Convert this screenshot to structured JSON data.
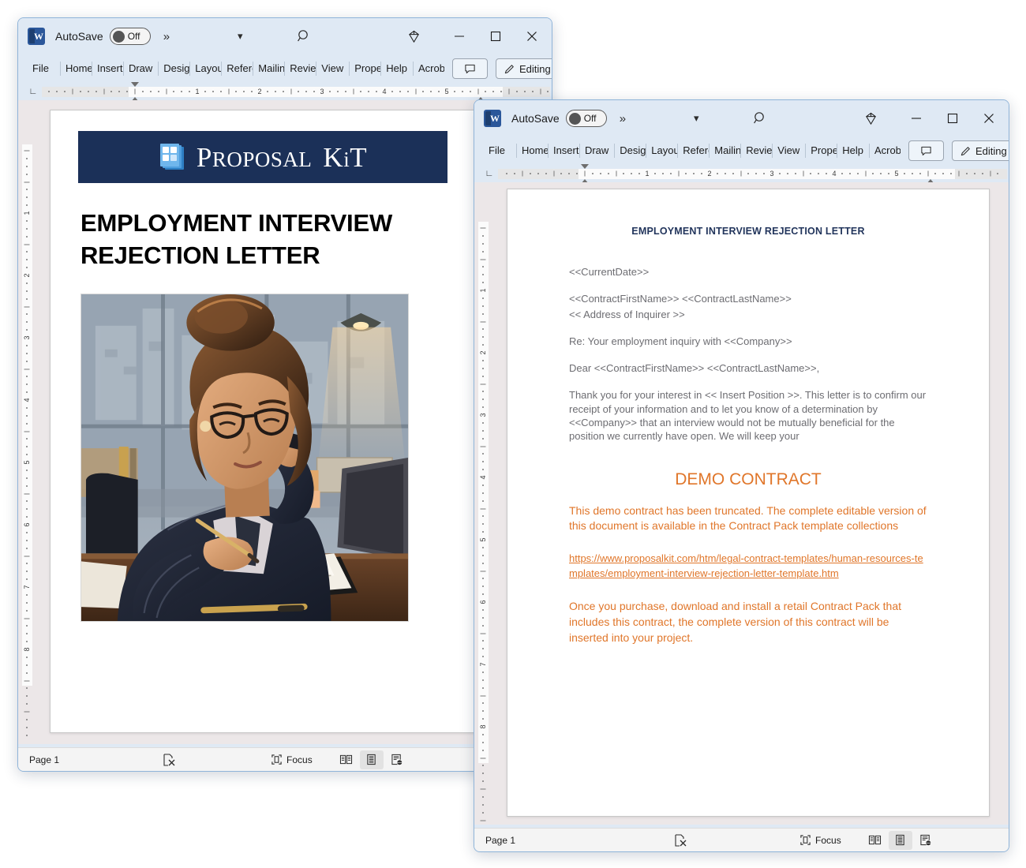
{
  "windows": [
    {
      "id": "window-1",
      "titlebar": {
        "app_icon": "word-icon",
        "autosave_label": "AutoSave",
        "autosave_state": "Off",
        "overflow_icon": "double-chevron-right-icon",
        "quick_access_dropdown_icon": "chevron-down-icon",
        "search_icon": "search-icon",
        "copilot_icon": "gem-icon",
        "minimize_icon": "minimize-icon",
        "maximize_icon": "maximize-icon",
        "close_icon": "close-icon"
      },
      "ribbon": {
        "tabs": [
          "File",
          "Home",
          "Insert",
          "Draw",
          "Design",
          "Layout",
          "References",
          "Mailings",
          "Review",
          "View",
          "Properties",
          "Help",
          "Acrobat"
        ],
        "comment_label": "",
        "comment_icon": "comment-icon",
        "editing_label": "Editing",
        "editing_icon": "pencil-icon",
        "more_icon": "chevron-right-icon"
      },
      "ruler": {
        "tab_stop_icon": "left-tab-stop-icon",
        "numbers": [
          "1",
          "2",
          "3",
          "4",
          "5"
        ],
        "vertical_numbers": [
          "1",
          "2",
          "3",
          "4",
          "5",
          "6",
          "7",
          "8"
        ]
      },
      "document": {
        "banner_logo_text_1": "P",
        "banner_logo_text_2": "ROPOSAL",
        "banner_logo_text_3": "K",
        "banner_logo_text_4": "i",
        "banner_logo_text_5": "T",
        "banner_color": "#1b3058",
        "heading": "EMPLOYMENT INTERVIEW REJECTION LETTER",
        "illustration": "businesswoman-writing-at-desk-illustration"
      },
      "statusbar": {
        "page_label": "Page 1",
        "wordcount_icon": "word-count-error-icon",
        "focus_icon": "focus-icon",
        "focus_label": "Focus",
        "view_read_icon": "read-mode-icon",
        "view_print_icon": "print-layout-icon",
        "view_web_icon": "web-layout-icon",
        "active_view": "print-layout"
      }
    },
    {
      "id": "window-2",
      "titlebar": {
        "app_icon": "word-icon",
        "autosave_label": "AutoSave",
        "autosave_state": "Off",
        "overflow_icon": "double-chevron-right-icon",
        "quick_access_dropdown_icon": "chevron-down-icon",
        "search_icon": "search-icon",
        "copilot_icon": "gem-icon",
        "minimize_icon": "minimize-icon",
        "maximize_icon": "maximize-icon",
        "close_icon": "close-icon"
      },
      "ribbon": {
        "tabs": [
          "File",
          "Home",
          "Insert",
          "Draw",
          "Design",
          "Layout",
          "References",
          "Mailings",
          "Review",
          "View",
          "Properties",
          "Help",
          "Acrobat"
        ],
        "comment_label": "",
        "comment_icon": "comment-icon",
        "editing_label": "Editing",
        "editing_icon": "pencil-icon",
        "more_icon": "chevron-right-icon"
      },
      "ruler": {
        "tab_stop_icon": "left-tab-stop-icon",
        "numbers": [
          "1",
          "2",
          "3",
          "4",
          "5"
        ],
        "vertical_numbers": [
          "1",
          "2",
          "3",
          "4",
          "5",
          "6",
          "7",
          "8"
        ]
      },
      "document": {
        "title": "EMPLOYMENT INTERVIEW REJECTION LETTER",
        "line_current_date": "<<CurrentDate>>",
        "line_name": "<<ContractFirstName>> <<ContractLastName>>",
        "line_address": "<< Address of Inquirer >>",
        "line_re": "Re: Your employment inquiry with <<Company>>",
        "line_dear": "Dear <<ContractFirstName>> <<ContractLastName>>,",
        "body_paragraph": "Thank you for your interest in << Insert Position >>. This letter is to confirm our receipt of your information and to let you know of a determination by <<Company>> that an interview would not be mutually beneficial for the position we currently have open. We will keep your",
        "demo_heading": "DEMO CONTRACT",
        "demo_paragraph_1": "This demo contract has been truncated. The complete editable version of this document is available in the Contract Pack template collections",
        "demo_link": "https://www.proposalkit.com/htm/legal-contract-templates/human-resources-templates/employment-interview-rejection-letter-template.htm",
        "demo_paragraph_2": "Once you purchase, download and install a retail Contract Pack that includes this contract, the complete version of this contract will be inserted into your project.",
        "accent_color": "#e0762a",
        "title_color": "#22355c",
        "body_color": "#6d6d72"
      },
      "statusbar": {
        "page_label": "Page 1",
        "wordcount_icon": "word-count-error-icon",
        "focus_icon": "focus-icon",
        "focus_label": "Focus",
        "view_read_icon": "read-mode-icon",
        "view_print_icon": "print-layout-icon",
        "view_web_icon": "web-layout-icon",
        "active_view": "print-layout"
      }
    }
  ]
}
